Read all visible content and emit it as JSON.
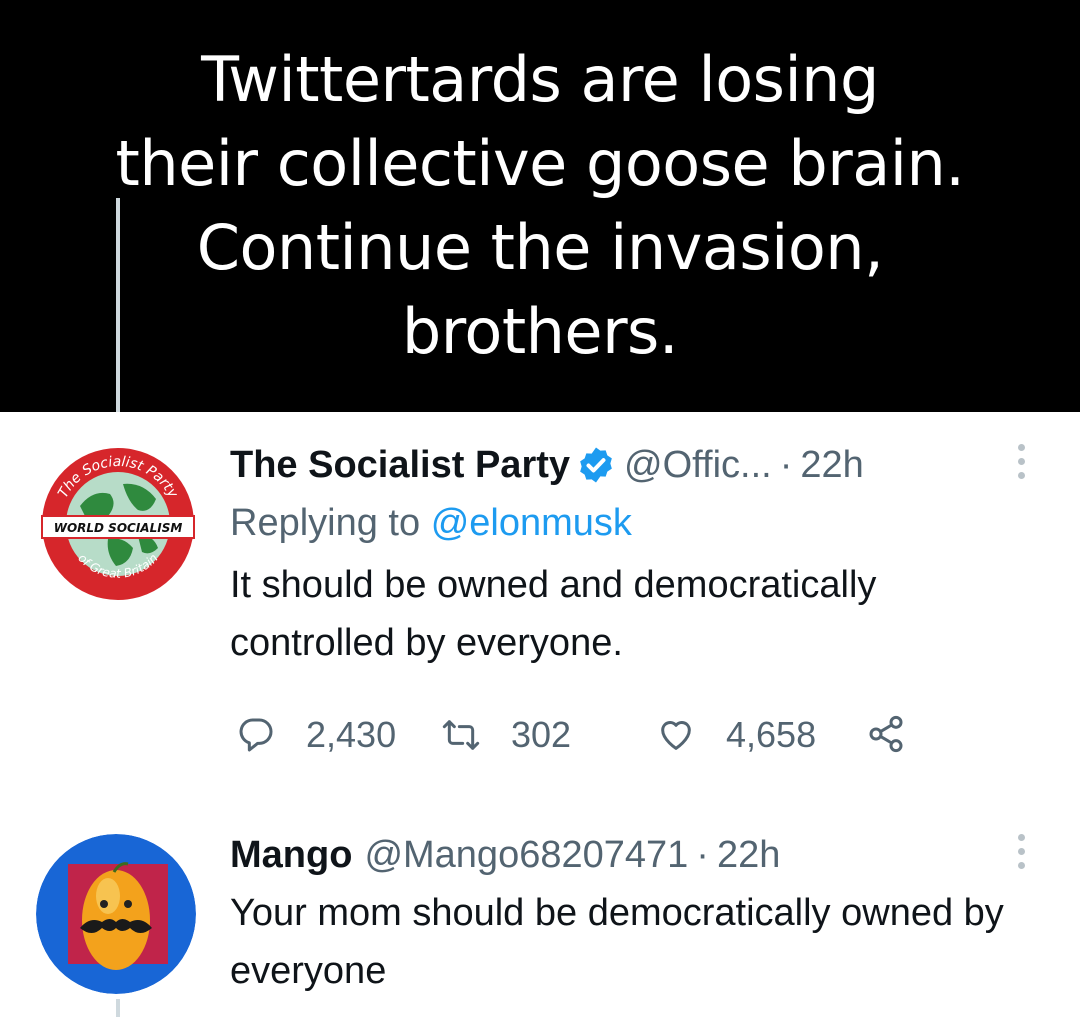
{
  "caption": {
    "lines": [
      "Twittertards are losing",
      "their collective goose brain.",
      "Continue the invasion,",
      "brothers."
    ]
  },
  "tweets": [
    {
      "display_name": "The Socialist Party",
      "verified": true,
      "handle": "@Offic...",
      "separator": "·",
      "time": "22h",
      "reply_prefix": "Replying to",
      "reply_mention": "@elonmusk",
      "text": "It should be owned and democratically controlled by everyone.",
      "avatar": {
        "top_text": "The Socialist Party",
        "banner_text": "WORLD SOCIALISM",
        "bottom_text": "of Great Britain",
        "colors": {
          "ring": "#d6262b",
          "globe": "#2f8a3e",
          "sea": "#b7dcc8"
        }
      },
      "stats": {
        "replies": "2,430",
        "retweets": "302",
        "likes": "4,658"
      },
      "icons": [
        "reply-icon",
        "retweet-icon",
        "like-icon",
        "share-icon"
      ]
    },
    {
      "display_name": "Mango",
      "handle": "@Mango68207471",
      "separator": "·",
      "time": "22h",
      "text": "Your mom should be democratically owned by everyone",
      "avatar": {
        "colors": {
          "bg": "#1866d6",
          "inner": "#c0244a",
          "mango": "#f3a21c"
        }
      }
    }
  ],
  "colors": {
    "text": "#0f1419",
    "secondary": "#536471",
    "accent": "#1d9bf0",
    "caption_bg": "#000000"
  }
}
